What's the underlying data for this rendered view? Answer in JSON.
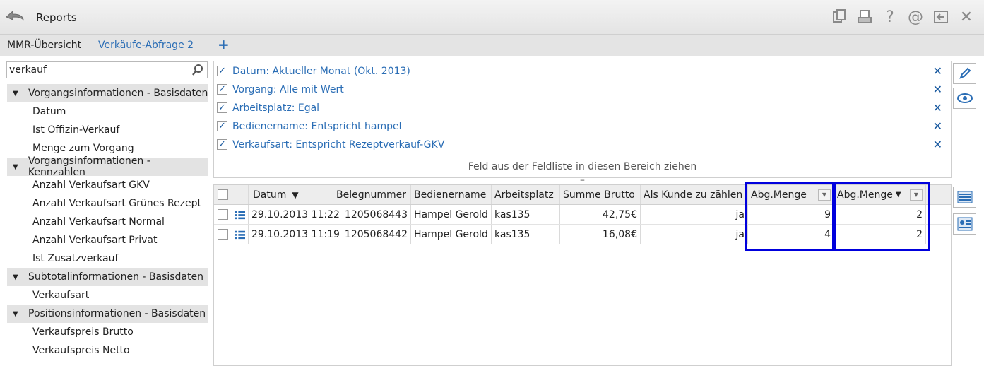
{
  "window": {
    "title": "Reports",
    "toolbar_icons": [
      "copy-icon",
      "print-icon",
      "help-icon",
      "at-icon",
      "export-icon",
      "close-icon"
    ],
    "help_glyph": "?",
    "at_glyph": "@",
    "close_glyph": "✕"
  },
  "tabs": {
    "overview": "MMR-Übersicht",
    "query": "Verkäufe-Abfrage 2",
    "add": "+"
  },
  "fieldlist": {
    "search_value": "verkauf",
    "groups": [
      {
        "label": "Vorgangsinformationen - Basisdaten",
        "items": [
          "Datum",
          "Ist Offizin-Verkauf",
          "Menge zum Vorgang"
        ]
      },
      {
        "label": "Vorgangsinformationen - Kennzahlen",
        "items": [
          "Anzahl Verkaufsart GKV",
          "Anzahl Verkaufsart Grünes Rezept",
          "Anzahl Verkaufsart Normal",
          "Anzahl Verkaufsart Privat",
          "Ist Zusatzverkauf"
        ]
      },
      {
        "label": "Subtotalinformationen - Basisdaten",
        "items": [
          "Verkaufsart"
        ]
      },
      {
        "label": "Positionsinformationen - Basisdaten",
        "items": [
          "Verkaufspreis Brutto",
          "Verkaufspreis Netto"
        ]
      }
    ]
  },
  "filters": {
    "items": [
      {
        "text": "Datum: Aktueller Monat   (Okt. 2013)",
        "checked": true
      },
      {
        "text": "Vorgang: Alle mit Wert",
        "checked": true
      },
      {
        "text": "Arbeitsplatz: Egal",
        "checked": true
      },
      {
        "text": "Bedienername: Entspricht hampel",
        "checked": true
      },
      {
        "text": "Verkaufsart: Entspricht Rezeptverkauf-GKV",
        "checked": true
      }
    ],
    "check_glyph": "✓",
    "delete_glyph": "✕",
    "drop_hint": "Feld aus der Feldliste in diesen Bereich ziehen",
    "splitter_glyph": "═"
  },
  "grid": {
    "headers": {
      "datum": "Datum",
      "sort_glyph": "▼",
      "belegnummer": "Belegnummer",
      "bedienername": "Bedienername",
      "arbeitsplatz": "Arbeitsplatz",
      "summe_brutto": "Summe Brutto",
      "als_kunde": "Als Kunde zu zählen",
      "abg_menge_1": "Abg.Menge",
      "abg_menge_2": "Abg.Menge",
      "filter_glyph": "▼",
      "dropdown_glyph": "▼"
    },
    "rows": [
      {
        "datum": "29.10.2013 11:22",
        "belegnummer": "1205068443",
        "bedienername": "Hampel Gerold",
        "arbeitsplatz": "kas135",
        "summe_brutto": "42,75€",
        "als_kunde": "ja",
        "abg_menge_1": "9",
        "abg_menge_2": "2"
      },
      {
        "datum": "29.10.2013 11:19",
        "belegnummer": "1205068442",
        "bedienername": "Hampel Gerold",
        "arbeitsplatz": "kas135",
        "summe_brutto": "16,08€",
        "als_kunde": "ja",
        "abg_menge_1": "4",
        "abg_menge_2": "2"
      }
    ]
  },
  "colors": {
    "accent": "#2a6db5",
    "highlight": "#0000dd"
  }
}
